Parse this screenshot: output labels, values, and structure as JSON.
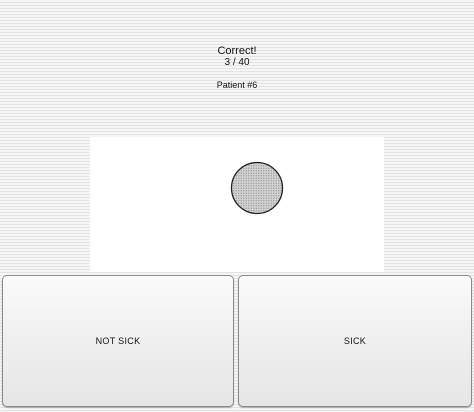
{
  "status": {
    "feedback": "Correct!",
    "progress": "3 / 40",
    "patient": "Patient #6"
  },
  "stimulus": {
    "shape": "circle",
    "fill_pattern": "dotted",
    "fill_color": "#c8c8c8",
    "outline_color": "#222222"
  },
  "buttons": {
    "not_sick_label": "NOT SICK",
    "sick_label": "SICK"
  }
}
